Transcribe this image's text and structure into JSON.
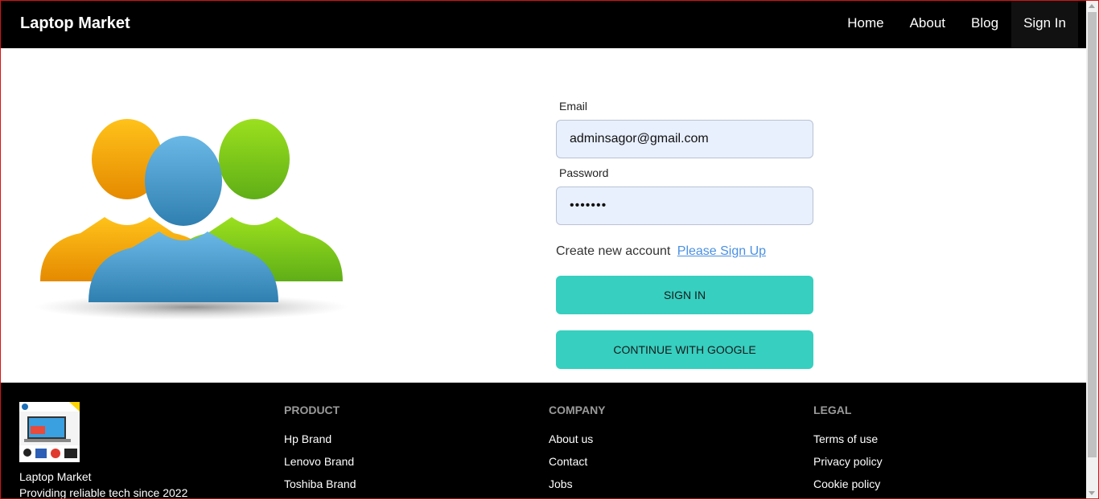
{
  "nav": {
    "brand": "Laptop Market",
    "links": [
      {
        "label": "Home"
      },
      {
        "label": "About"
      },
      {
        "label": "Blog"
      },
      {
        "label": "Sign In"
      }
    ]
  },
  "form": {
    "email_label": "Email",
    "email_value": "adminsagor@gmail.com",
    "password_label": "Password",
    "password_value": "•••••••",
    "create_text": "Create new account",
    "signup_link": "Please Sign Up",
    "signin_button": "SIGN IN",
    "google_button": "CONTINUE WITH GOOGLE"
  },
  "colors": {
    "accent": "#36cfc0",
    "input_bg": "#e8f0fe",
    "nav_bg": "#000000",
    "link": "#4a90e2"
  },
  "footer": {
    "brand": "Laptop Market",
    "tagline": "Providing reliable tech since 2022",
    "product": {
      "title": "PRODUCT",
      "items": [
        "Hp Brand",
        "Lenovo Brand",
        "Toshiba Brand"
      ]
    },
    "company": {
      "title": "COMPANY",
      "items": [
        "About us",
        "Contact",
        "Jobs"
      ]
    },
    "legal": {
      "title": "LEGAL",
      "items": [
        "Terms of use",
        "Privacy policy",
        "Cookie policy"
      ]
    }
  }
}
